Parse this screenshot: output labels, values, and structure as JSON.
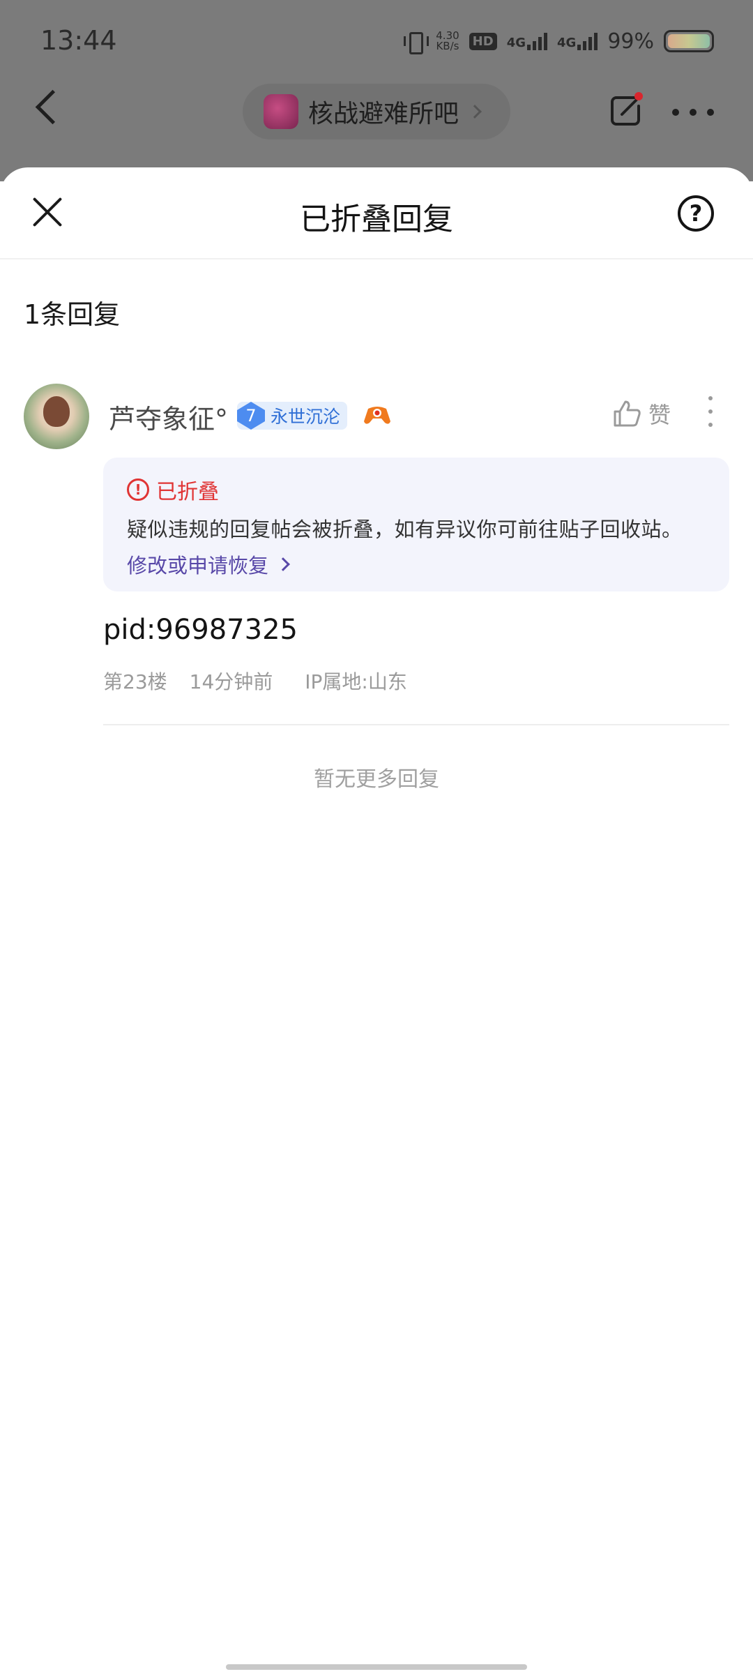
{
  "status_bar": {
    "time": "13:44",
    "net_speed": "4.30",
    "net_speed_unit": "KB/s",
    "hd_badge": "HD",
    "net1": "4G",
    "net2": "4G",
    "battery_pct": "99%"
  },
  "top_nav": {
    "forum_name": "核战避难所吧"
  },
  "sheet": {
    "title": "已折叠回复",
    "help_symbol": "?"
  },
  "reply_count": "1条回复",
  "comment": {
    "username": "芦夺象征°",
    "level": "7",
    "level_name": "永世沉沦",
    "like_label": "赞",
    "folded": {
      "warn_symbol": "!",
      "label": "已折叠",
      "description": "疑似违规的回复帖会被折叠，如有异议你可前往贴子回收站。",
      "restore_link": "修改或申请恢复"
    },
    "content": "pid:96987325",
    "floor": "第23楼",
    "time_ago": "14分钟前",
    "ip_location": "IP属地:山东"
  },
  "footer_text": "暂无更多回复",
  "colors": {
    "accent_red": "#e03434",
    "link_purple": "#5848a8",
    "level_blue": "#4d8cf0"
  }
}
